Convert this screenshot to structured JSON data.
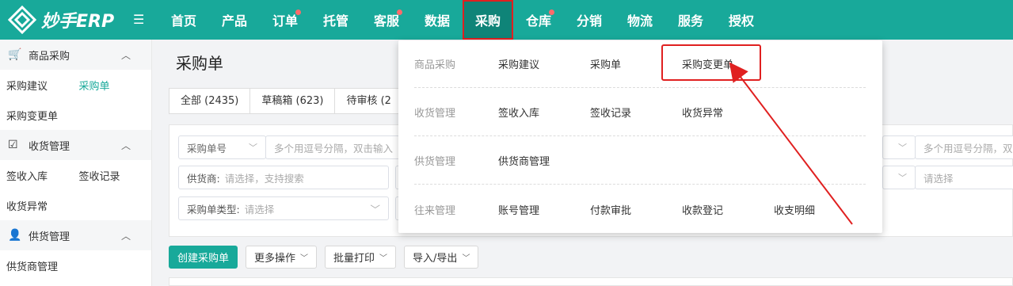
{
  "header": {
    "logo_text": "妙手ERP",
    "nav": [
      {
        "label": "首页",
        "dot": false,
        "active": false
      },
      {
        "label": "产品",
        "dot": false,
        "active": false
      },
      {
        "label": "订单",
        "dot": true,
        "active": false
      },
      {
        "label": "托管",
        "dot": false,
        "active": false
      },
      {
        "label": "客服",
        "dot": true,
        "active": false
      },
      {
        "label": "数据",
        "dot": false,
        "active": false
      },
      {
        "label": "采购",
        "dot": false,
        "active": true
      },
      {
        "label": "仓库",
        "dot": true,
        "active": false
      },
      {
        "label": "分销",
        "dot": false,
        "active": false
      },
      {
        "label": "物流",
        "dot": false,
        "active": false
      },
      {
        "label": "服务",
        "dot": false,
        "active": false
      },
      {
        "label": "授权",
        "dot": false,
        "active": false
      }
    ]
  },
  "sidebar": {
    "groups": [
      {
        "title": "商品采购",
        "links": [
          [
            "采购建议",
            "采购单"
          ],
          [
            "采购变更单"
          ]
        ]
      },
      {
        "title": "收货管理",
        "links": [
          [
            "签收入库",
            "签收记录"
          ],
          [
            "收货异常"
          ]
        ]
      },
      {
        "title": "供货管理",
        "links": [
          [
            "供货商管理"
          ]
        ]
      }
    ],
    "current": "采购单"
  },
  "main": {
    "title": "采购单",
    "tabs": [
      "全部 (2435)",
      "草稿箱 (623)",
      "待审核 (2"
    ],
    "filters": {
      "order_no_select": "采购单号",
      "order_no_placeholder": "多个用逗号分隔，双击输入",
      "supplier_label": "供货商:",
      "supplier_placeholder": "请选择，支持搜索",
      "type_label": "采购单类型:",
      "type_placeholder": "请选择",
      "right_input_placeholder": "多个用逗号分隔，双击",
      "right_select_placeholder": "请选择"
    },
    "actions": {
      "create": "创建采购单",
      "more": "更多操作",
      "print": "批量打印",
      "import_export": "导入/导出"
    }
  },
  "dropdown": {
    "rows": [
      {
        "category": "商品采购",
        "items": [
          "采购建议",
          "采购单",
          "采购变更单"
        ]
      },
      {
        "category": "收货管理",
        "items": [
          "签收入库",
          "签收记录",
          "收货异常"
        ]
      },
      {
        "category": "供货管理",
        "items": [
          "供货商管理"
        ]
      },
      {
        "category": "往来管理",
        "items": [
          "账号管理",
          "付款审批",
          "收款登记",
          "收支明细"
        ]
      }
    ]
  },
  "colors": {
    "brand": "#18a99a",
    "highlight": "#e02020"
  }
}
